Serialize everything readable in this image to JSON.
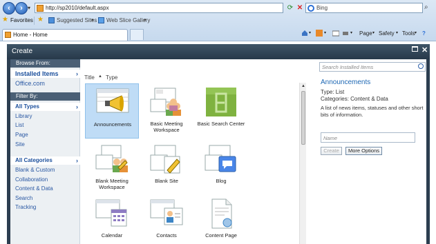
{
  "browser": {
    "address": "http://sp2010/default.aspx",
    "search_placeholder": "Bing",
    "favorites_label": "Favorites",
    "suggested_sites": "Suggested Sites",
    "web_slice_gallery": "Web Slice Gallery",
    "tab_title": "Home - Home",
    "commands": {
      "page": "Page",
      "safety": "Safety",
      "tools": "Tools"
    }
  },
  "dialog": {
    "title": "Create",
    "browse_from": {
      "header": "Browse From:",
      "items": [
        "Installed Items",
        "Office.com"
      ]
    },
    "filter_by": {
      "header": "Filter By:",
      "types": [
        "All Types",
        "Library",
        "List",
        "Page",
        "Site"
      ],
      "categories": [
        "All Categories",
        "Blank & Custom",
        "Collaboration",
        "Content & Data",
        "Search",
        "Tracking"
      ]
    },
    "sort": {
      "title": "Title",
      "type": "Type"
    },
    "tiles": [
      {
        "label": "Announcements",
        "icon": "megaphone-icon"
      },
      {
        "label": "Basic Meeting Workspace",
        "icon": "meeting-workspace-icon"
      },
      {
        "label": "Basic Search Center",
        "icon": "search-center-icon"
      },
      {
        "label": "Blank Meeting Workspace",
        "icon": "blank-meeting-icon"
      },
      {
        "label": "Blank Site",
        "icon": "blank-site-icon"
      },
      {
        "label": "Blog",
        "icon": "blog-icon"
      },
      {
        "label": "Calendar",
        "icon": "calendar-icon"
      },
      {
        "label": "Contacts",
        "icon": "contacts-icon"
      },
      {
        "label": "Content Page",
        "icon": "content-page-icon"
      }
    ],
    "details": {
      "search_placeholder": "Search Installed Items",
      "title": "Announcements",
      "type": "Type: List",
      "categories": "Categories: Content & Data",
      "description": "A list of news items, statuses and other short bits of information.",
      "name_placeholder": "Name",
      "create_label": "Create",
      "more_options_label": "More Options"
    }
  },
  "colors": {
    "header": "#2f4354",
    "link": "#2a58a3",
    "selected_tile": "#bfdcf6",
    "title_blue": "#1b66b3"
  }
}
